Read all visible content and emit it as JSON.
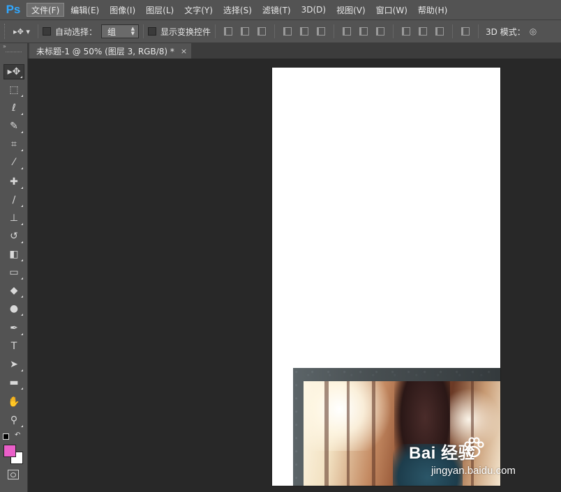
{
  "app": {
    "logo": "Ps"
  },
  "menu": [
    {
      "label": "文件(F)",
      "active": true
    },
    {
      "label": "编辑(E)"
    },
    {
      "label": "图像(I)"
    },
    {
      "label": "图层(L)"
    },
    {
      "label": "文字(Y)"
    },
    {
      "label": "选择(S)"
    },
    {
      "label": "滤镜(T)"
    },
    {
      "label": "3D(D)"
    },
    {
      "label": "视图(V)"
    },
    {
      "label": "窗口(W)"
    },
    {
      "label": "帮助(H)"
    }
  ],
  "options": {
    "tool_icon": "move-tool-icon",
    "auto_select_label": "自动选择：",
    "auto_select_value": "组",
    "show_transform_label": "显示变换控件",
    "mode_3d_label": "3D 模式："
  },
  "tab": {
    "title": "未标题-1 @ 50% (图层 3, RGB/8) *",
    "close": "×"
  },
  "toolbox": {
    "collapse": "»",
    "foreground_color": "#ea5fc9",
    "background_color": "#ffffff",
    "tools": [
      {
        "name": "move-tool",
        "glyph": "▸✥"
      },
      {
        "name": "marquee-tool",
        "glyph": "⬚"
      },
      {
        "name": "lasso-tool",
        "glyph": "ℓ"
      },
      {
        "name": "quick-select-tool",
        "glyph": "✎"
      },
      {
        "name": "crop-tool",
        "glyph": "⌗"
      },
      {
        "name": "eyedropper-tool",
        "glyph": "⁄"
      },
      {
        "name": "healing-brush-tool",
        "glyph": "✚"
      },
      {
        "name": "brush-tool",
        "glyph": "∕"
      },
      {
        "name": "clone-stamp-tool",
        "glyph": "⊥"
      },
      {
        "name": "history-brush-tool",
        "glyph": "↺"
      },
      {
        "name": "eraser-tool",
        "glyph": "◧"
      },
      {
        "name": "gradient-tool",
        "glyph": "▭"
      },
      {
        "name": "blur-tool",
        "glyph": "◆"
      },
      {
        "name": "dodge-tool",
        "glyph": "●"
      },
      {
        "name": "pen-tool",
        "glyph": "✒"
      },
      {
        "name": "type-tool",
        "glyph": "T"
      },
      {
        "name": "path-select-tool",
        "glyph": "➤"
      },
      {
        "name": "rectangle-tool",
        "glyph": "▬"
      },
      {
        "name": "hand-tool",
        "glyph": "✋"
      },
      {
        "name": "zoom-tool",
        "glyph": "⚲"
      }
    ]
  },
  "document": {
    "canvas_color": "#ffffff"
  },
  "watermark": {
    "brand": "Bai  经验",
    "url": "jingyan.baidu.com"
  }
}
